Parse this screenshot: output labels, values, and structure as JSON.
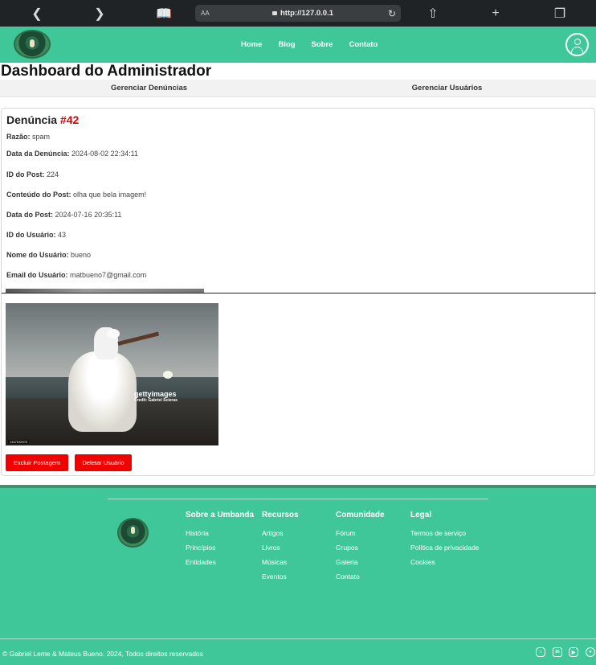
{
  "browser": {
    "url_text": "http://127.0.0.1",
    "text_size_label": "AA"
  },
  "header": {
    "nav": [
      "Home",
      "Blog",
      "Sobre",
      "Contato"
    ]
  },
  "dashboard": {
    "title": "Dashboard do Administrador",
    "tabs": [
      "Gerenciar Denúncias",
      "Gerenciar Usuários"
    ]
  },
  "report": {
    "title_prefix": "Denúncia",
    "number": "#42",
    "fields": [
      {
        "label": "Razão:",
        "value": "spam"
      },
      {
        "label": "Data da Denúncia:",
        "value": "2024-08-02 22:34:11"
      },
      {
        "label": "ID do Post:",
        "value": "224"
      },
      {
        "label": "Conteúdo do Post:",
        "value": "olha que bela imagem!"
      },
      {
        "label": "Data do Post:",
        "value": "2024-07-16 20:35:11"
      },
      {
        "label": "ID do Usuário:",
        "value": "43"
      },
      {
        "label": "Nome do Usuário:",
        "value": "bueno"
      },
      {
        "label": "Email do Usuário:",
        "value": "matbueno7@gmail.com"
      }
    ],
    "image_watermark": "gettyimages",
    "image_credit": "Credit: Gabriel Scieras",
    "image_id": "1467638976",
    "buttons": {
      "delete_post": "Excluir Postagem",
      "delete_user": "Deletar Usuário"
    }
  },
  "footer": {
    "columns": [
      {
        "title": "Sobre a Umbanda",
        "items": [
          "História",
          "Princípios",
          "Entidades"
        ]
      },
      {
        "title": "Recursos",
        "items": [
          "Artigos",
          "Livros",
          "Músicas",
          "Eventos"
        ]
      },
      {
        "title": "Comunidade",
        "items": [
          "Fórum",
          "Grupos",
          "Galeria",
          "Contato"
        ]
      },
      {
        "title": "Legal",
        "items": [
          "Termos de serviço",
          "Política de privacidade",
          "Cookies"
        ]
      }
    ],
    "copyright": "© Gabriel Leme & Mateus Bueno. 2024, Todos direitos reservados",
    "social_icons": [
      "instagram-icon",
      "linkedin-icon",
      "youtube-icon",
      "github-icon"
    ]
  },
  "colors": {
    "brand_green": "#3fc79a",
    "danger_red": "#f20000",
    "report_number_red": "#e00000"
  }
}
